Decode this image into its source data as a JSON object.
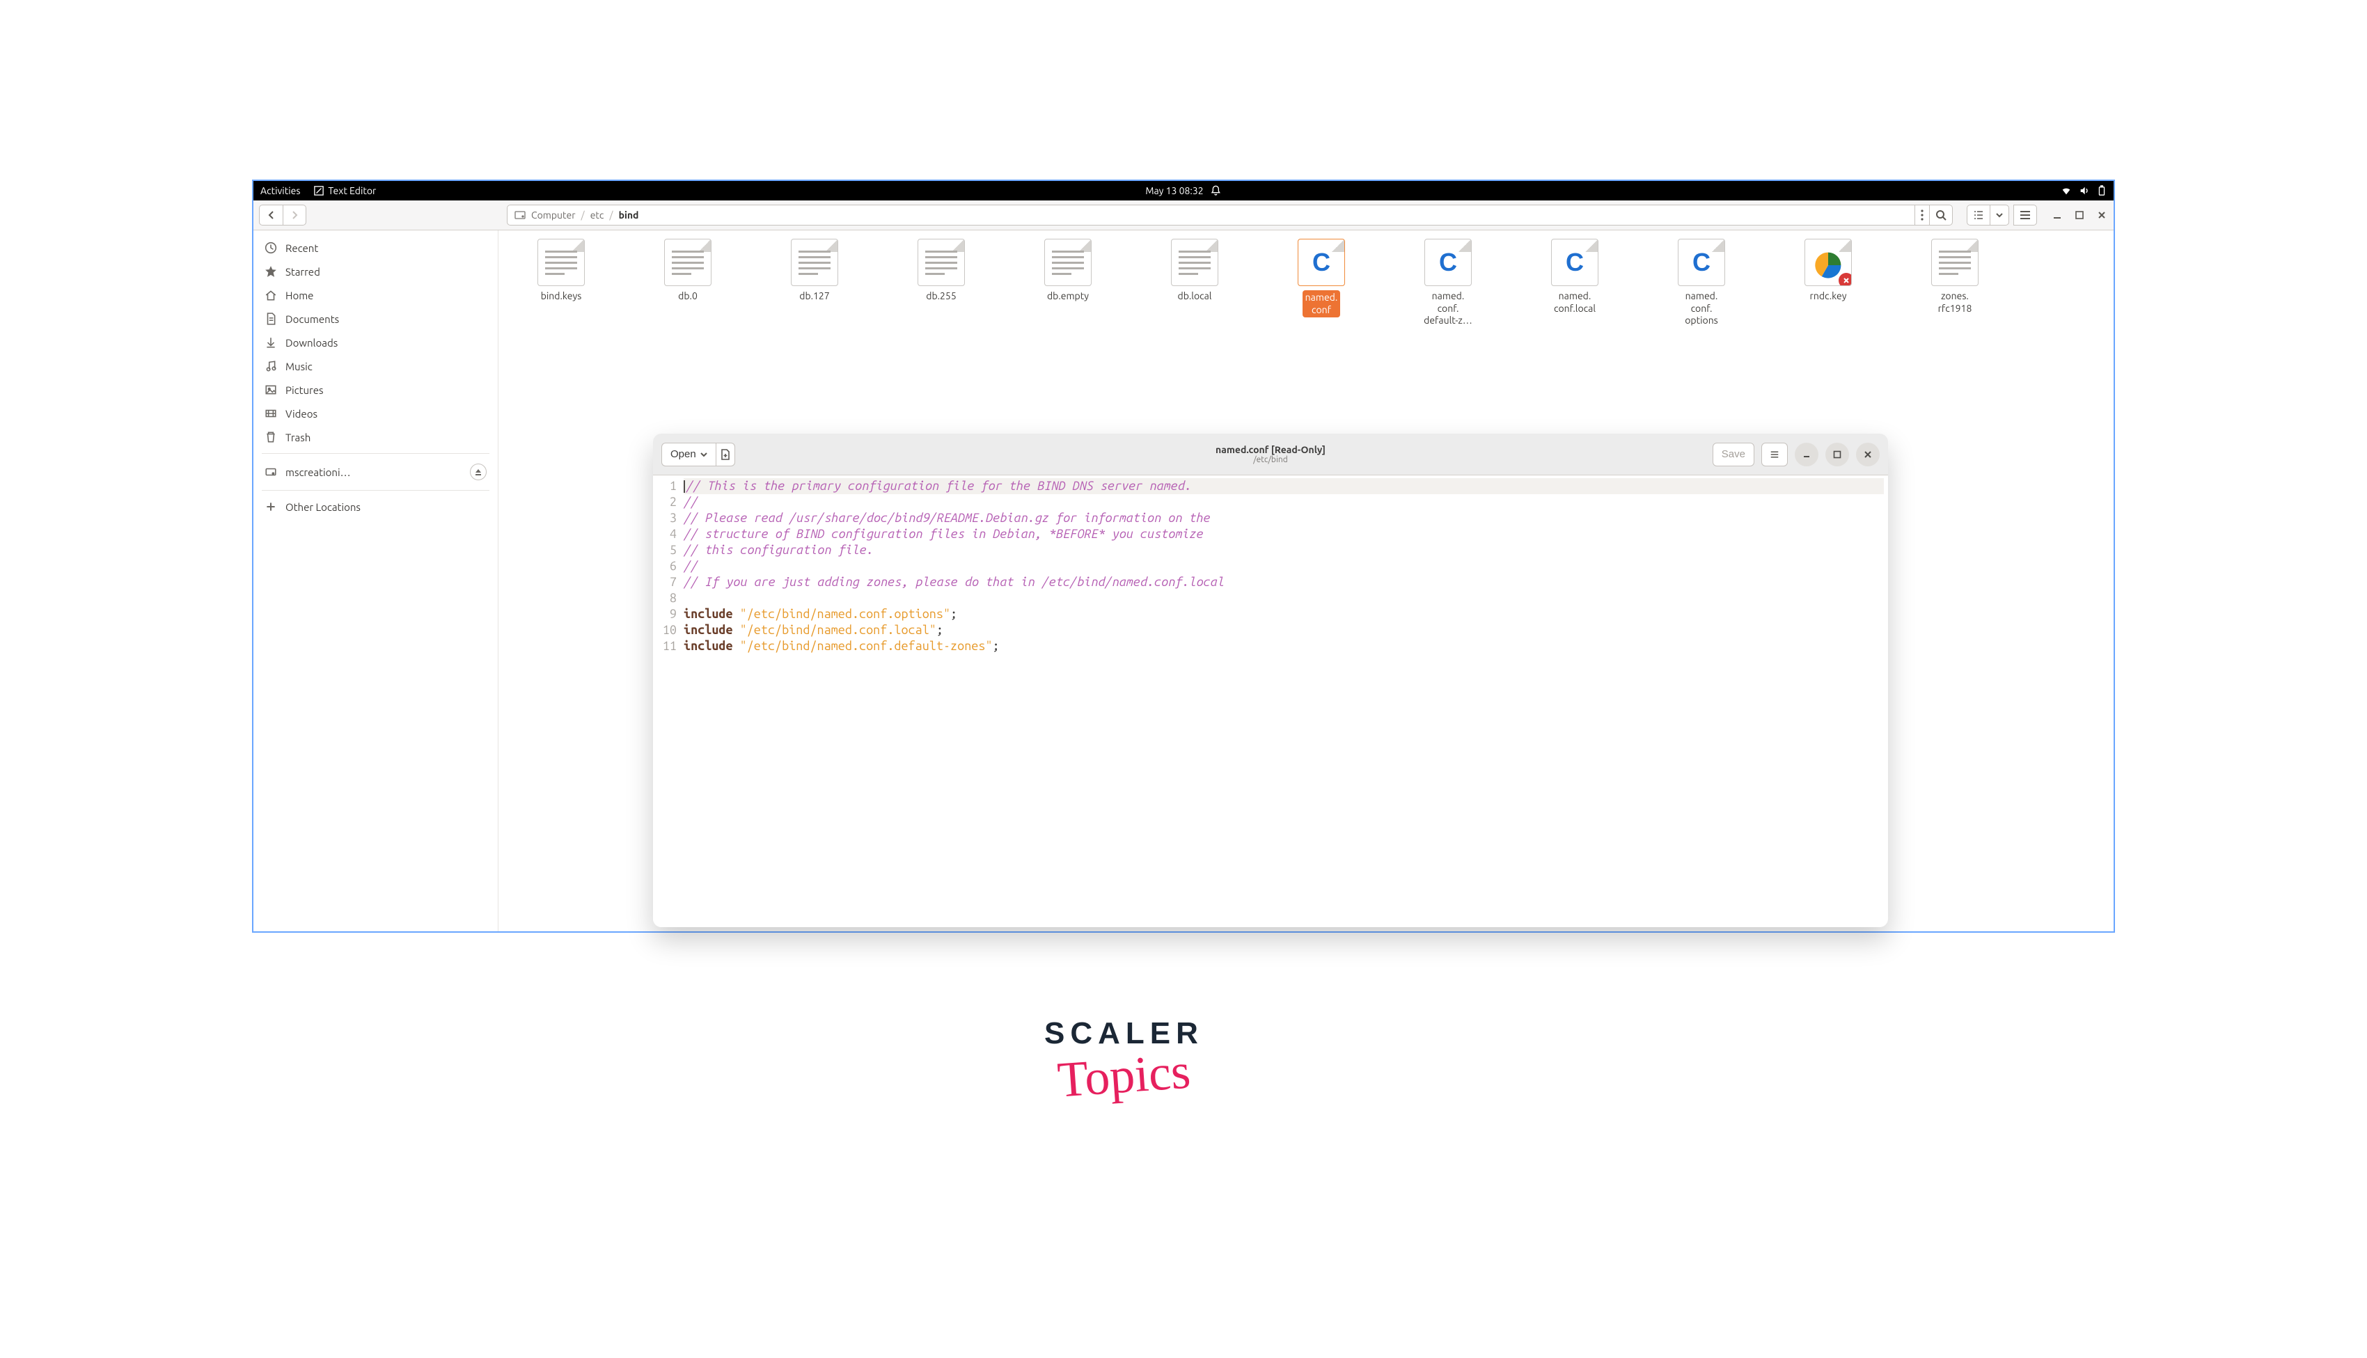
{
  "topbar": {
    "activities": "Activities",
    "app_name": "Text Editor",
    "datetime": "May 13  08:32"
  },
  "file_manager": {
    "path": {
      "root": "Computer",
      "segs": [
        "etc",
        "bind"
      ]
    },
    "sidebar": [
      {
        "icon": "clock",
        "label": "Recent"
      },
      {
        "icon": "star",
        "label": "Starred"
      },
      {
        "icon": "home",
        "label": "Home"
      },
      {
        "icon": "doc",
        "label": "Documents"
      },
      {
        "icon": "down",
        "label": "Downloads"
      },
      {
        "icon": "music",
        "label": "Music"
      },
      {
        "icon": "pic",
        "label": "Pictures"
      },
      {
        "icon": "video",
        "label": "Videos"
      },
      {
        "icon": "trash",
        "label": "Trash"
      },
      {
        "icon": "disk",
        "label": "mscreationi…",
        "eject": true
      },
      {
        "icon": "plus",
        "label": "Other Locations"
      }
    ],
    "files": [
      {
        "name": "bind.keys",
        "type": "txt"
      },
      {
        "name": "db.0",
        "type": "txt"
      },
      {
        "name": "db.127",
        "type": "txt"
      },
      {
        "name": "db.255",
        "type": "txt"
      },
      {
        "name": "db.empty",
        "type": "txt"
      },
      {
        "name": "db.local",
        "type": "txt"
      },
      {
        "name": "named.\nconf",
        "type": "c",
        "selected": true
      },
      {
        "name": "named.\nconf.\ndefault-z…",
        "type": "c"
      },
      {
        "name": "named.\nconf.local",
        "type": "c"
      },
      {
        "name": "named.\nconf.\noptions",
        "type": "c"
      },
      {
        "name": "rndc.key",
        "type": "chart",
        "badge": "x"
      },
      {
        "name": "zones.\nrfc1918",
        "type": "txt"
      }
    ]
  },
  "editor": {
    "open_label": "Open",
    "title_line1": "named.conf [Read-Only]",
    "title_line2": "/etc/bind",
    "save_label": "Save",
    "code": {
      "lines": [
        {
          "n": 1,
          "type": "comment",
          "text": "// This is the primary configuration file for the BIND DNS server named."
        },
        {
          "n": 2,
          "type": "comment",
          "text": "//"
        },
        {
          "n": 3,
          "type": "comment",
          "text": "// Please read /usr/share/doc/bind9/README.Debian.gz for information on the"
        },
        {
          "n": 4,
          "type": "comment",
          "text": "// structure of BIND configuration files in Debian, *BEFORE* you customize"
        },
        {
          "n": 5,
          "type": "comment",
          "text": "// this configuration file."
        },
        {
          "n": 6,
          "type": "comment",
          "text": "//"
        },
        {
          "n": 7,
          "type": "comment",
          "text": "// If you are just adding zones, please do that in /etc/bind/named.conf.local"
        },
        {
          "n": 8,
          "type": "blank",
          "text": ""
        },
        {
          "n": 9,
          "type": "include",
          "kw": "include ",
          "str": "\"/etc/bind/named.conf.options\"",
          "semi": ";"
        },
        {
          "n": 10,
          "type": "include",
          "kw": "include ",
          "str": "\"/etc/bind/named.conf.local\"",
          "semi": ";"
        },
        {
          "n": 11,
          "type": "include",
          "kw": "include ",
          "str": "\"/etc/bind/named.conf.default-zones\"",
          "semi": ";"
        }
      ]
    }
  },
  "branding": {
    "word1": "SCALER",
    "word2": "Topics"
  }
}
